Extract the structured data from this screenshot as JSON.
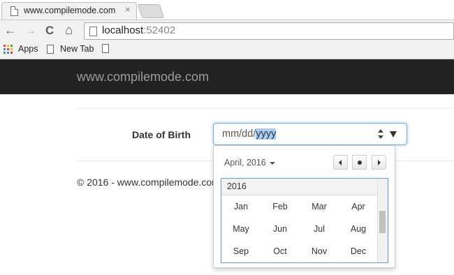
{
  "browser": {
    "tab_title": "www.compilemode.com - ",
    "tab_close": "×",
    "back": "←",
    "forward": "→",
    "reload": "C",
    "home": "⌂",
    "url_host": "localhost",
    "url_port": ":52402",
    "bookmarks": {
      "apps_label": "Apps",
      "new_tab_label": "New Tab"
    },
    "apps_colors": [
      "#ea4335",
      "#fbbc05",
      "#34a853",
      "#4285f4",
      "#ea4335",
      "#fbbc05",
      "#34a853",
      "#4285f4",
      "#ea4335"
    ]
  },
  "navbar": {
    "brand": "www.compilemode.com"
  },
  "form": {
    "dob_label": "Date of Birth",
    "date_value_prefix": "mm/dd/",
    "date_value_selected": "yyyy"
  },
  "footer": {
    "text": "© 2016 - www.compilemode.com"
  },
  "datepicker": {
    "month_label": "April, 2016",
    "year": "2016",
    "months": [
      [
        "Jan",
        "Feb",
        "Mar",
        "Apr"
      ],
      [
        "May",
        "Jun",
        "Jul",
        "Aug"
      ],
      [
        "Sep",
        "Oct",
        "Nov",
        "Dec"
      ]
    ]
  },
  "colors": {
    "navbar_bg": "#222222",
    "focus_border": "#66afe9",
    "selection": "#a6cef5"
  }
}
